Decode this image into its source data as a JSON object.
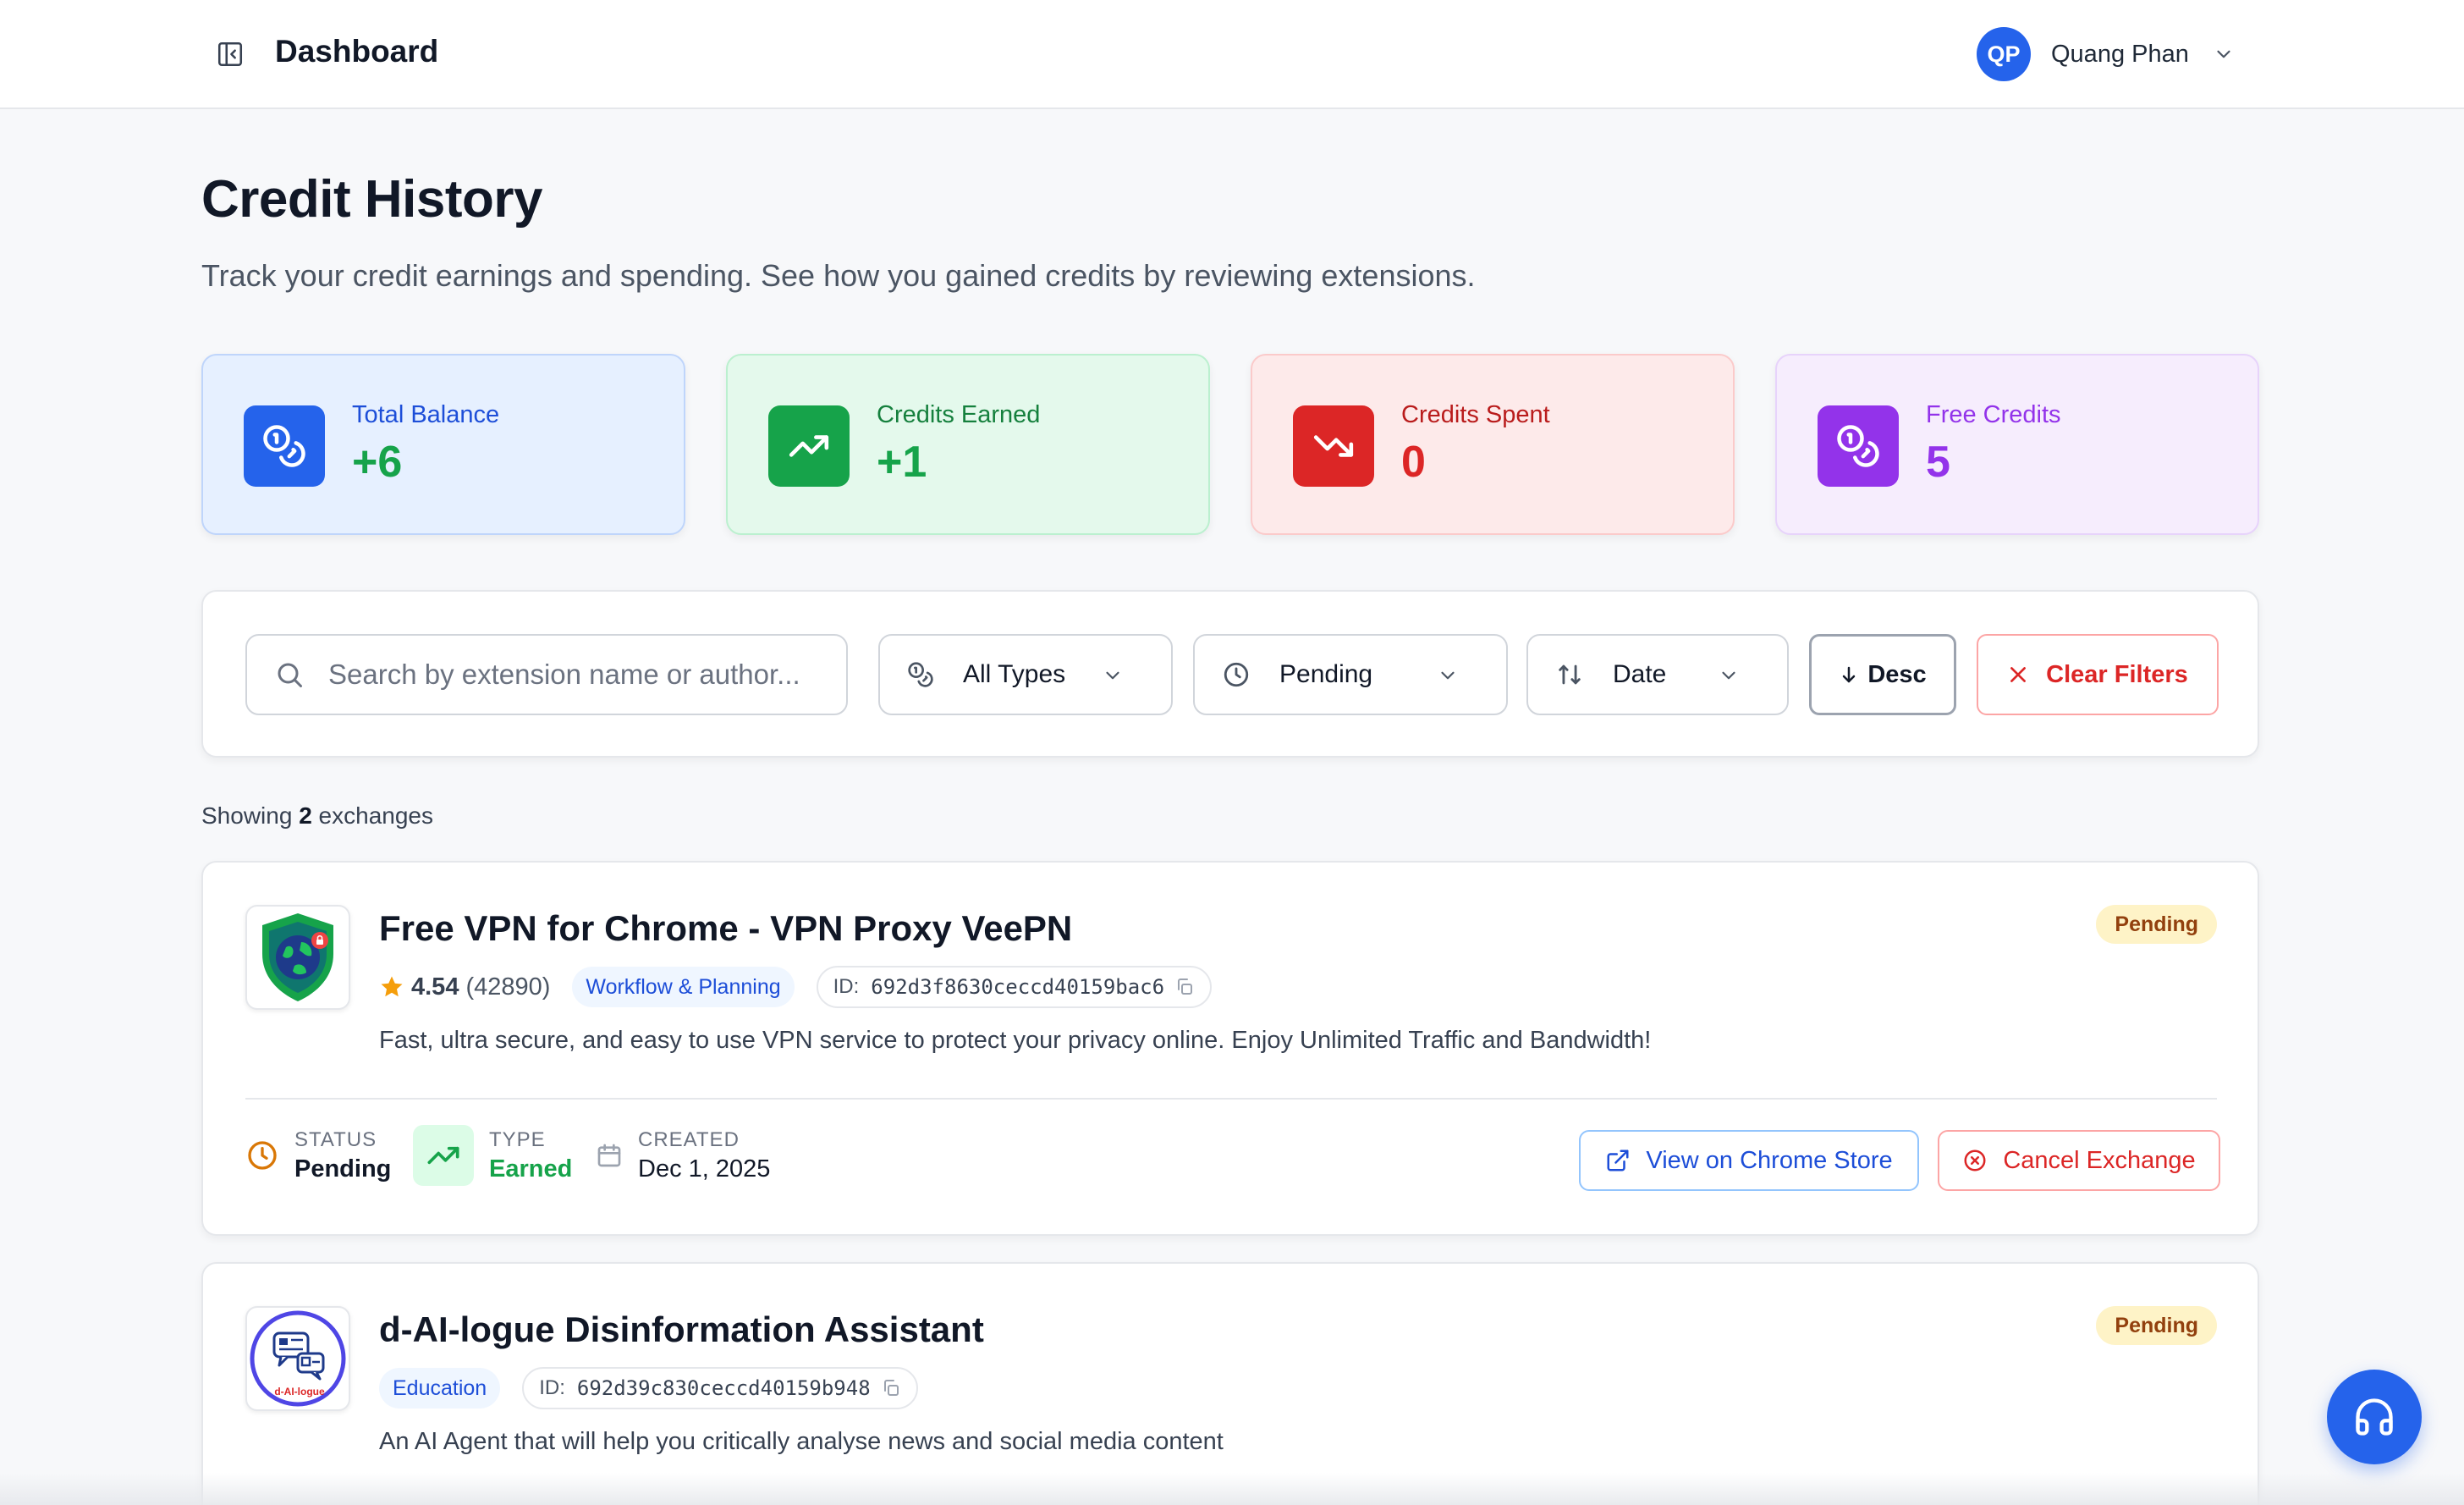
{
  "header": {
    "title": "Dashboard",
    "user": {
      "initials": "QP",
      "name": "Quang Phan"
    }
  },
  "page": {
    "title": "Credit History",
    "subtitle": "Track your credit earnings and spending. See how you gained credits by reviewing extensions."
  },
  "stats": [
    {
      "label": "Total Balance",
      "value": "+6",
      "label_color": "#1d4ed8",
      "value_color": "#16a34a",
      "bg": "#e6f0ff",
      "border": "#bfd5fb",
      "icon_bg": "#2563eb"
    },
    {
      "label": "Credits Earned",
      "value": "+1",
      "label_color": "#15803d",
      "value_color": "#16a34a",
      "bg": "#e4f9ec",
      "border": "#bbf0cf",
      "icon_bg": "#16a34a"
    },
    {
      "label": "Credits Spent",
      "value": "0",
      "label_color": "#b91c1c",
      "value_color": "#dc2626",
      "bg": "#fdeaea",
      "border": "#fbcaca",
      "icon_bg": "#dc2626"
    },
    {
      "label": "Free Credits",
      "value": "5",
      "label_color": "#9333ea",
      "value_color": "#9333ea",
      "bg": "#f6edfd",
      "border": "#e7d3fb",
      "icon_bg": "#9333ea"
    }
  ],
  "filters": {
    "search_placeholder": "Search by extension name or author...",
    "type": "All Types",
    "status": "Pending",
    "sort": "Date",
    "order": "Desc",
    "clear": "Clear Filters"
  },
  "results": {
    "prefix": "Showing",
    "count": "2",
    "suffix": "exchanges"
  },
  "exchanges": [
    {
      "title": "Free VPN for Chrome - VPN Proxy VeePN",
      "rating": "4.54",
      "reviews": "(42890)",
      "category": "Workflow & Planning",
      "id_label": "ID:",
      "id": "692d3f8630ceccd40159bac6",
      "description": "Fast, ultra secure, and easy to use VPN service to protect your privacy online. Enjoy Unlimited Traffic and Bandwidth!",
      "badge": "Pending",
      "status_label": "Status",
      "status": "Pending",
      "type_label": "Type",
      "type": "Earned",
      "created_label": "Created",
      "created": "Dec 1, 2025",
      "store_button": "View on Chrome Store",
      "cancel_button": "Cancel Exchange"
    },
    {
      "title": "d-AI-logue Disinformation Assistant",
      "category": "Education",
      "id_label": "ID:",
      "id": "692d39c830ceccd40159b948",
      "description": "An AI Agent that will help you critically analyse news and social media content",
      "badge": "Pending",
      "logo_text": "d-AI-logue"
    }
  ],
  "colors": {
    "accent": "#2563eb",
    "pending_bg": "#fef3c7",
    "pending_text": "#92400e",
    "danger": "#dc2626",
    "success": "#16a34a"
  }
}
